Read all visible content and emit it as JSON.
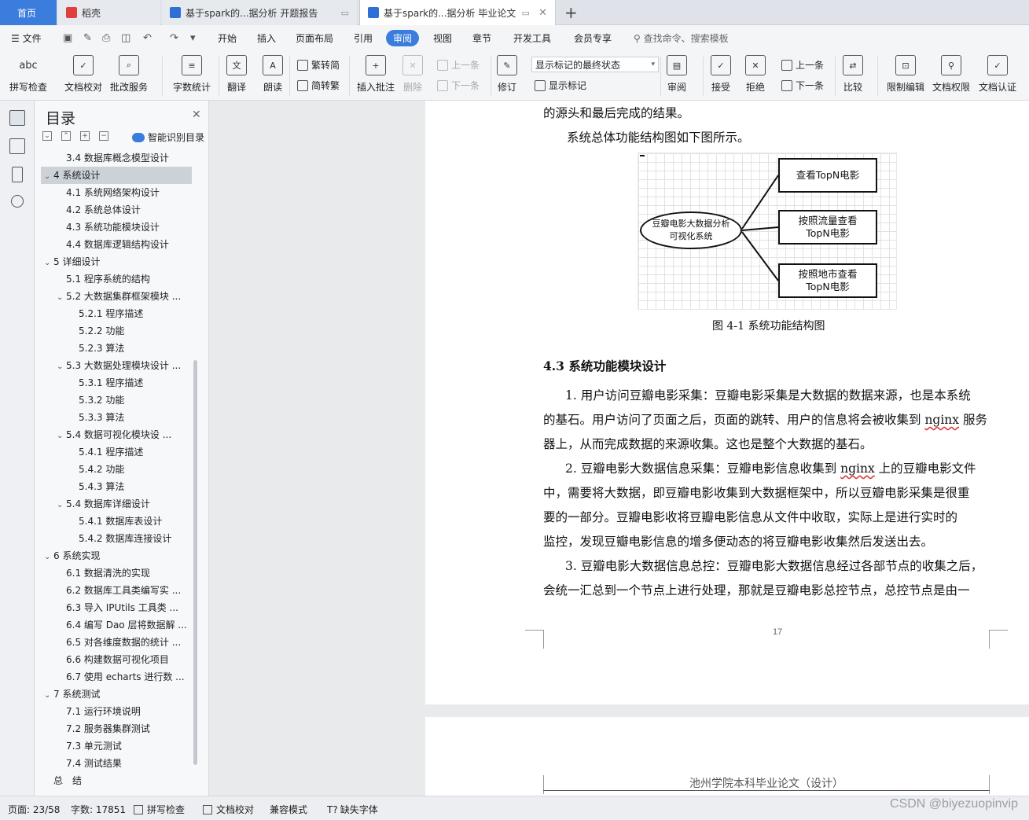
{
  "tabs": {
    "home": "首页",
    "daoke": "稻壳",
    "doc1": "基于spark的...据分析 开题报告",
    "doc2": "基于spark的...据分析 毕业论文",
    "add": "+"
  },
  "menubar": {
    "file": "文件",
    "items": [
      "开始",
      "插入",
      "页面布局",
      "引用",
      "审阅",
      "视图",
      "章节",
      "开发工具",
      "会员专享"
    ],
    "active": "审阅",
    "search": "查找命令、搜索模板"
  },
  "ribbon": {
    "spellcheck": "拼写检查",
    "doccheck": "文档校对",
    "batch": "批改服务",
    "wordcount": "字数统计",
    "translate": "翻译",
    "read": "朗读",
    "trad_to_simp": "繁转简",
    "simp_to_trad": "简转繁",
    "insert_comment": "插入批注",
    "delete": "删除",
    "prev_comment": "上一条",
    "next_comment": "下一条",
    "revise": "修订",
    "markup_state": "显示标记的最终状态",
    "show_markup": "显示标记",
    "review": "审阅",
    "accept": "接受",
    "reject": "拒绝",
    "prev": "上一条",
    "next": "下一条",
    "compare": "比较",
    "restrict": "限制编辑",
    "permission": "文档权限",
    "certify": "文档认证"
  },
  "toc": {
    "title": "目录",
    "smart": "智能识别目录",
    "items": [
      {
        "level": 2,
        "text": "3.4 数据库概念模型设计",
        "caret": ""
      },
      {
        "level": 1,
        "text": "4 系统设计",
        "caret": "v",
        "selected": true
      },
      {
        "level": 2,
        "text": "4.1 系统网络架构设计",
        "caret": ""
      },
      {
        "level": 2,
        "text": "4.2 系统总体设计",
        "caret": ""
      },
      {
        "level": 2,
        "text": "4.3 系统功能模块设计",
        "caret": ""
      },
      {
        "level": 2,
        "text": "4.4 数据库逻辑结构设计",
        "caret": ""
      },
      {
        "level": 1,
        "text": "5 详细设计",
        "caret": "v"
      },
      {
        "level": 2,
        "text": "5.1 程序系统的结构",
        "caret": ""
      },
      {
        "level": 2,
        "text": "5.2 大数据集群框架模块 ...",
        "caret": "v"
      },
      {
        "level": 3,
        "text": "5.2.1 程序描述",
        "caret": ""
      },
      {
        "level": 3,
        "text": "5.2.2 功能",
        "caret": ""
      },
      {
        "level": 3,
        "text": "5.2.3 算法",
        "caret": ""
      },
      {
        "level": 2,
        "text": "5.3 大数据处理模块设计 ...",
        "caret": "v"
      },
      {
        "level": 3,
        "text": "5.3.1 程序描述",
        "caret": ""
      },
      {
        "level": 3,
        "text": "5.3.2 功能",
        "caret": ""
      },
      {
        "level": 3,
        "text": "5.3.3 算法",
        "caret": ""
      },
      {
        "level": 2,
        "text": "5.4 数据可视化模块设 ...",
        "caret": "v"
      },
      {
        "level": 3,
        "text": "5.4.1 程序描述",
        "caret": ""
      },
      {
        "level": 3,
        "text": "5.4.2 功能",
        "caret": ""
      },
      {
        "level": 3,
        "text": "5.4.3 算法",
        "caret": ""
      },
      {
        "level": 2,
        "text": "5.4 数据库详细设计",
        "caret": "v"
      },
      {
        "level": 3,
        "text": "5.4.1 数据库表设计",
        "caret": ""
      },
      {
        "level": 3,
        "text": "5.4.2 数据库连接设计",
        "caret": ""
      },
      {
        "level": 1,
        "text": "6 系统实现",
        "caret": "v"
      },
      {
        "level": 2,
        "text": "6.1 数据清洗的实现",
        "caret": ""
      },
      {
        "level": 2,
        "text": "6.2 数据库工具类编写实 ...",
        "caret": ""
      },
      {
        "level": 2,
        "text": "6.3 导入 IPUtils 工具类 ...",
        "caret": ""
      },
      {
        "level": 2,
        "text": "6.4 编写 Dao 层将数据解 ...",
        "caret": ""
      },
      {
        "level": 2,
        "text": "6.5 对各维度数据的统计 ...",
        "caret": ""
      },
      {
        "level": 2,
        "text": "6.6 构建数据可视化项目",
        "caret": ""
      },
      {
        "level": 2,
        "text": "6.7 使用 echarts 进行数 ...",
        "caret": ""
      },
      {
        "level": 1,
        "text": "7 系统测试",
        "caret": "v"
      },
      {
        "level": 2,
        "text": "7.1 运行环境说明",
        "caret": ""
      },
      {
        "level": 2,
        "text": "7.2 服务器集群测试",
        "caret": ""
      },
      {
        "level": 2,
        "text": "7.3 单元测试",
        "caret": ""
      },
      {
        "level": 2,
        "text": "7.4 测试结果",
        "caret": ""
      },
      {
        "level": 1,
        "text": "总　结",
        "caret": ""
      }
    ]
  },
  "doc": {
    "line_top": "的源头和最后完成的结果。",
    "diagram_intro": "系统总体功能结构图如下图所示。",
    "diagram": {
      "center_line1": "豆瓣电影大数据分析",
      "center_line2": "可视化系统",
      "box1": "查看TopN电影",
      "box2_line1": "按照流量查看",
      "box2_line2": "TopN电影",
      "box3_line1": "按照地市查看",
      "box3_line2": "TopN电影"
    },
    "caption": "图 4-1 系统功能结构图",
    "heading": "4.3  系统功能模块设计",
    "p1_l1": "1. 用户访问豆瓣电影采集：豆瓣电影采集是大数据的数据来源，也是本系统",
    "p1_l2a": "的基石。用户访问了页面之后，页面的跳转、用户的信息将会被收集到 ",
    "p1_l2b": "nginx",
    "p1_l2c": " 服务",
    "p1_l3": "器上，从而完成数据的来源收集。这也是整个大数据的基石。",
    "p2_l1a": "2. 豆瓣电影大数据信息采集：豆瓣电影信息收集到 ",
    "p2_l1b": "nginx",
    "p2_l1c": " 上的豆瓣电影文件",
    "p2_l2": "中，需要将大数据，即豆瓣电影收集到大数据框架中，所以豆瓣电影采集是很重",
    "p2_l3": "要的一部分。豆瓣电影收将豆瓣电影信息从文件中收取，实际上是进行实时的",
    "p2_l4": "监控，发现豆瓣电影信息的增多便动态的将豆瓣电影收集然后发送出去。",
    "p3_l1": "3. 豆瓣电影大数据信息总控：豆瓣电影大数据信息经过各部节点的收集之后，",
    "p3_l2": "会统一汇总到一个节点上进行处理，那就是豆瓣电影总控节点，总控节点是由一",
    "page_number": "17",
    "next_header": "池州学院本科毕业论文（设计）"
  },
  "status": {
    "page": "页面: 23/58",
    "words": "字数: 17851",
    "spell": "拼写检查",
    "proof": "文档校对",
    "compat": "兼容模式",
    "missing_font": "缺失字体"
  },
  "watermark": "CSDN @biyezuopinvip",
  "colors": {
    "accent": "#3b7ddd",
    "toc_selected": "#cdd2d9",
    "page": "#ffffff",
    "canvas": "#e9eaec"
  }
}
